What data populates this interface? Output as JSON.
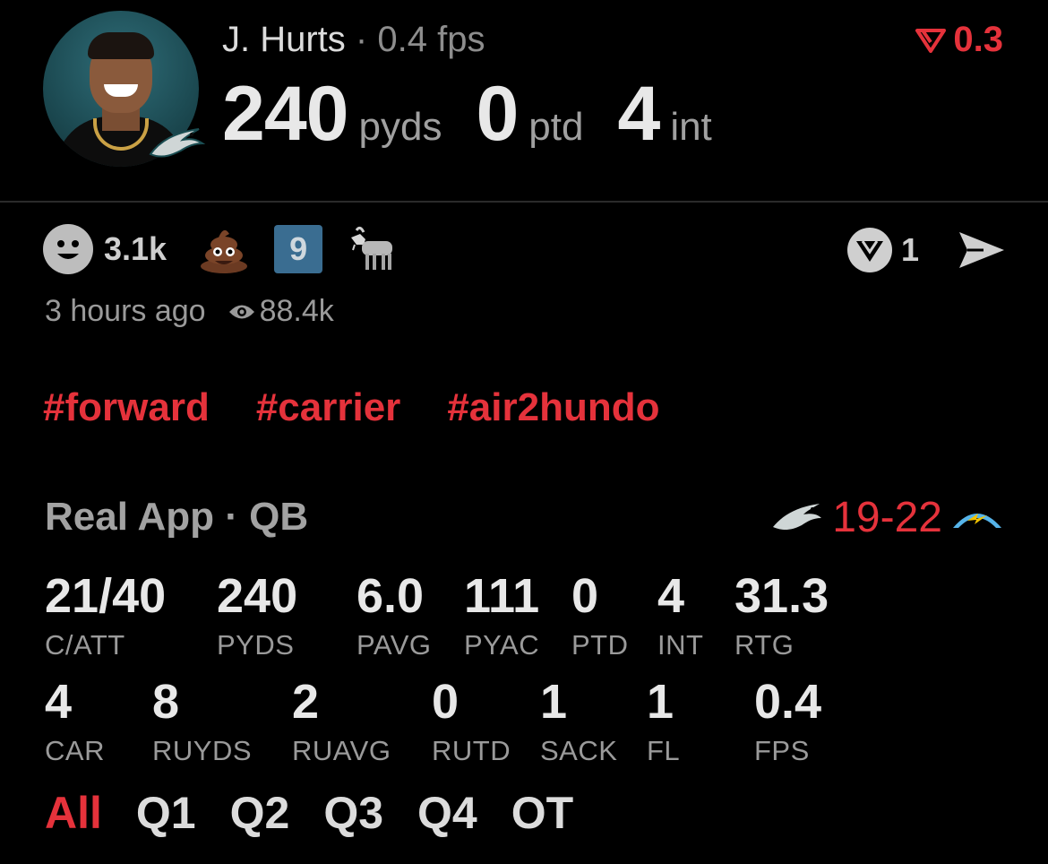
{
  "header": {
    "player_name": "J. Hurts",
    "separator": "·",
    "fps_label": "0.4 fps",
    "delta_value": "0.3",
    "big_stats": [
      {
        "value": "240",
        "unit": "pyds"
      },
      {
        "value": "0",
        "unit": "ptd"
      },
      {
        "value": "4",
        "unit": "int"
      }
    ]
  },
  "reactions": {
    "smile_count": "3.1k",
    "badge_number": "9",
    "share_count": "1",
    "icons": [
      "smile-icon",
      "poop-emoji-icon",
      "nine-keycap-icon",
      "goat-emoji-icon",
      "real-logo-icon",
      "send-icon"
    ]
  },
  "meta": {
    "time_ago": "3 hours ago",
    "views": "88.4k"
  },
  "hashtags": [
    "#forward",
    "#carrier",
    "#air2hundo"
  ],
  "section": {
    "title": "Real App · QB",
    "score": "19-22",
    "home_team_icon": "eagles-logo-icon",
    "away_team_icon": "chargers-logo-icon"
  },
  "stats_row1": [
    {
      "value": "21/40",
      "label": "C/ATT"
    },
    {
      "value": "240",
      "label": "PYDS"
    },
    {
      "value": "6.0",
      "label": "PAVG"
    },
    {
      "value": "111",
      "label": "PYAC"
    },
    {
      "value": "0",
      "label": "PTD"
    },
    {
      "value": "4",
      "label": "INT"
    },
    {
      "value": "31.3",
      "label": "RTG"
    }
  ],
  "stats_row2": [
    {
      "value": "4",
      "label": "CAR"
    },
    {
      "value": "8",
      "label": "RUYDS"
    },
    {
      "value": "2",
      "label": "RUAVG"
    },
    {
      "value": "0",
      "label": "RUTD"
    },
    {
      "value": "1",
      "label": "SACK"
    },
    {
      "value": "1",
      "label": "FL"
    },
    {
      "value": "0.4",
      "label": "FPS"
    }
  ],
  "tabs": [
    {
      "label": "All",
      "active": true
    },
    {
      "label": "Q1",
      "active": false
    },
    {
      "label": "Q2",
      "active": false
    },
    {
      "label": "Q3",
      "active": false
    },
    {
      "label": "Q4",
      "active": false
    },
    {
      "label": "OT",
      "active": false
    }
  ],
  "colors": {
    "accent_red": "#e5323b",
    "background": "#000000",
    "muted_text": "#9a9a9a"
  }
}
